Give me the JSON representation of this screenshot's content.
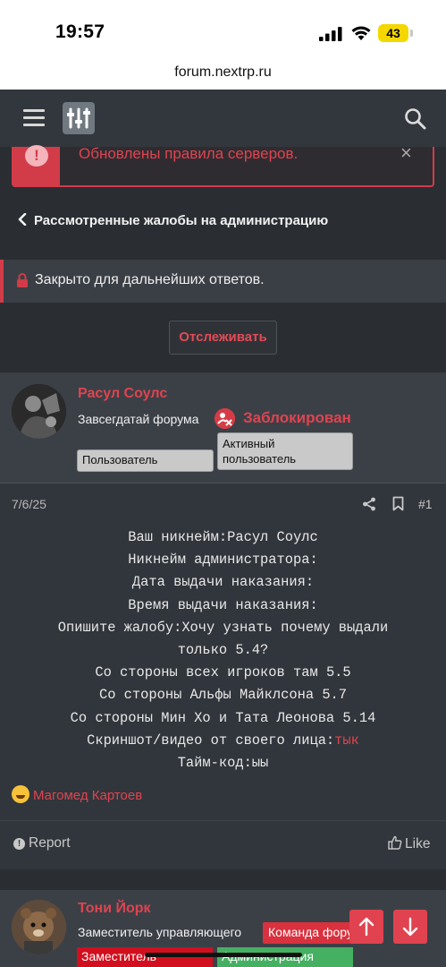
{
  "status_bar": {
    "time": "19:57",
    "battery": "43"
  },
  "browser": {
    "url": "forum.nextrp.ru"
  },
  "notice": {
    "text": "Обновлены правила серверов.",
    "close": "×"
  },
  "breadcrumb": {
    "label": "Рассмотренные жалобы на администрацию"
  },
  "thread_status": {
    "text": "Закрыто для дальнейших ответов."
  },
  "watch_button": {
    "label": "Отслеживать"
  },
  "post1": {
    "author": "Расул Соулс",
    "user_title": "Завсегдатай форума",
    "ban_label": "Заблокирован",
    "banners": [
      "Пользователь",
      "Активный пользователь"
    ],
    "date": "7/6/25",
    "number": "#1",
    "lines": [
      "Ваш никнейм:Расул Соулс",
      "Никнейм администратора:",
      "Дата выдачи наказания:",
      "Время выдачи наказания:",
      "Опишите жалобу:Хочу узнать почему выдали",
      "только 5.4?",
      "Со стороны всех игроков там 5.5",
      "Со стороны Альфы Майклсона 5.7",
      "Со стороны Мин Хо и Тата Леонова 5.14"
    ],
    "screenshot_label": "Скриншот/видео от своего лица:",
    "screenshot_link": "тык",
    "timecode": "Тайм-код:ыы",
    "reaction_user": "Магомед Картоев",
    "report": "Report",
    "like": "Like"
  },
  "post2": {
    "author": "Тони Йорк",
    "user_title": "Заместитель управляющего",
    "team_tag": "Команда форума",
    "banners": [
      "Заместитель",
      "Администрация"
    ]
  },
  "colors": {
    "accent": "#e0434f",
    "background": "#2a2e33",
    "post": "#31363c"
  }
}
